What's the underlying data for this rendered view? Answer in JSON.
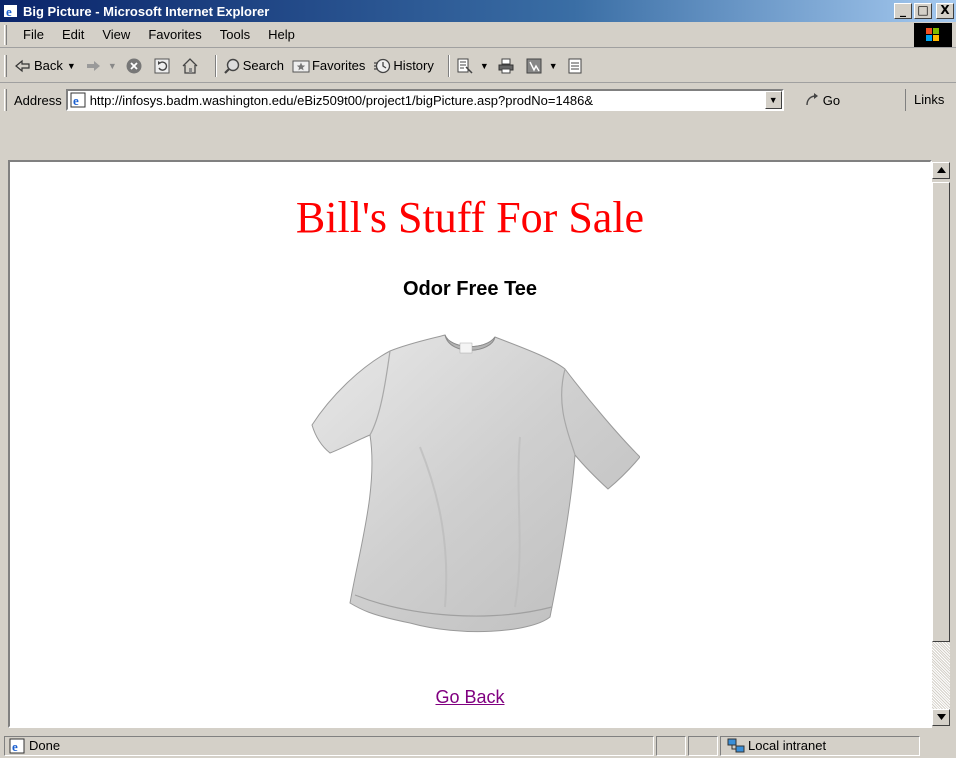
{
  "window": {
    "title": "Big Picture - Microsoft Internet Explorer",
    "buttons": [
      "_",
      "□",
      "X"
    ]
  },
  "menubar": {
    "items": [
      "File",
      "Edit",
      "View",
      "Favorites",
      "Tools",
      "Help"
    ]
  },
  "toolbar": {
    "back_label": "Back",
    "search_label": "Search",
    "favorites_label": "Favorites",
    "history_label": "History"
  },
  "addressbar": {
    "label": "Address",
    "url": "http://infosys.badm.washington.edu/eBiz509t00/project1/bigPicture.asp?prodNo=1486&",
    "go_label": "Go",
    "links_label": "Links"
  },
  "page": {
    "site_title": "Bill's Stuff For Sale",
    "product_name": "Odor Free Tee",
    "back_link": "Go Back"
  },
  "statusbar": {
    "status_text": "Done",
    "zone_text": "Local intranet"
  },
  "colors": {
    "title_red": "#ff0000",
    "visited_link": "#800080",
    "titlebar_blue": "#0a246a"
  }
}
